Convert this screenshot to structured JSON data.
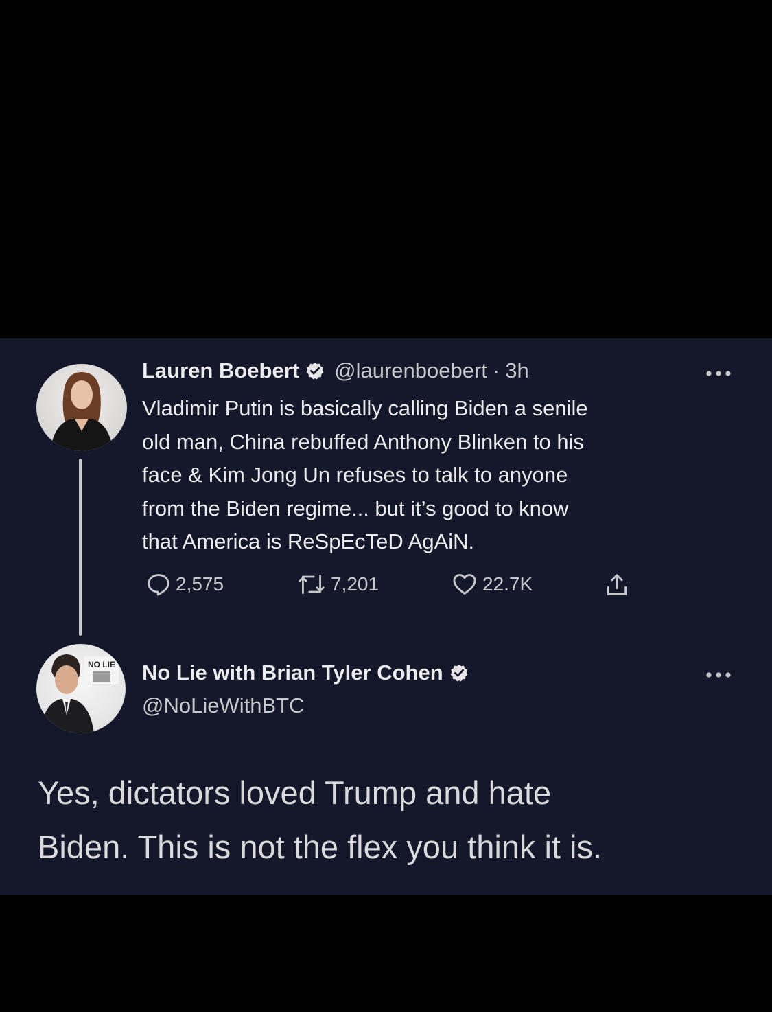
{
  "tweet": {
    "author_name": "Lauren Boebert",
    "handle": "@laurenboebert",
    "separator": "·",
    "time": "3h",
    "text_lines": [
      "Vladimir Putin is basically calling Biden a senile",
      "old man, China rebuffed Anthony Blinken to his",
      "face & Kim Jong Un refuses to talk to anyone",
      "from the Biden regime... but it’s good to know",
      "that America is ReSpEcTeD AgAiN."
    ],
    "replies": "2,575",
    "retweets": "7,201",
    "likes": "22.7K"
  },
  "reply_tweet": {
    "author_name": "No Lie with Brian Tyler Cohen",
    "handle": "@NoLieWithBTC",
    "avatar_sign_text": "NO LIE",
    "text_lines": [
      "Yes, dictators loved Trump and hate",
      "Biden. This is not the flex you think it is."
    ]
  },
  "colors": {
    "panel_background": "#15182a",
    "page_background": "#000000",
    "verified_badge": "#e6e6e8"
  },
  "icons": {
    "reply": "reply-icon",
    "retweet": "retweet-icon",
    "like": "heart-icon",
    "share": "share-icon",
    "more": "more-icon",
    "verified": "verified-badge-icon"
  }
}
